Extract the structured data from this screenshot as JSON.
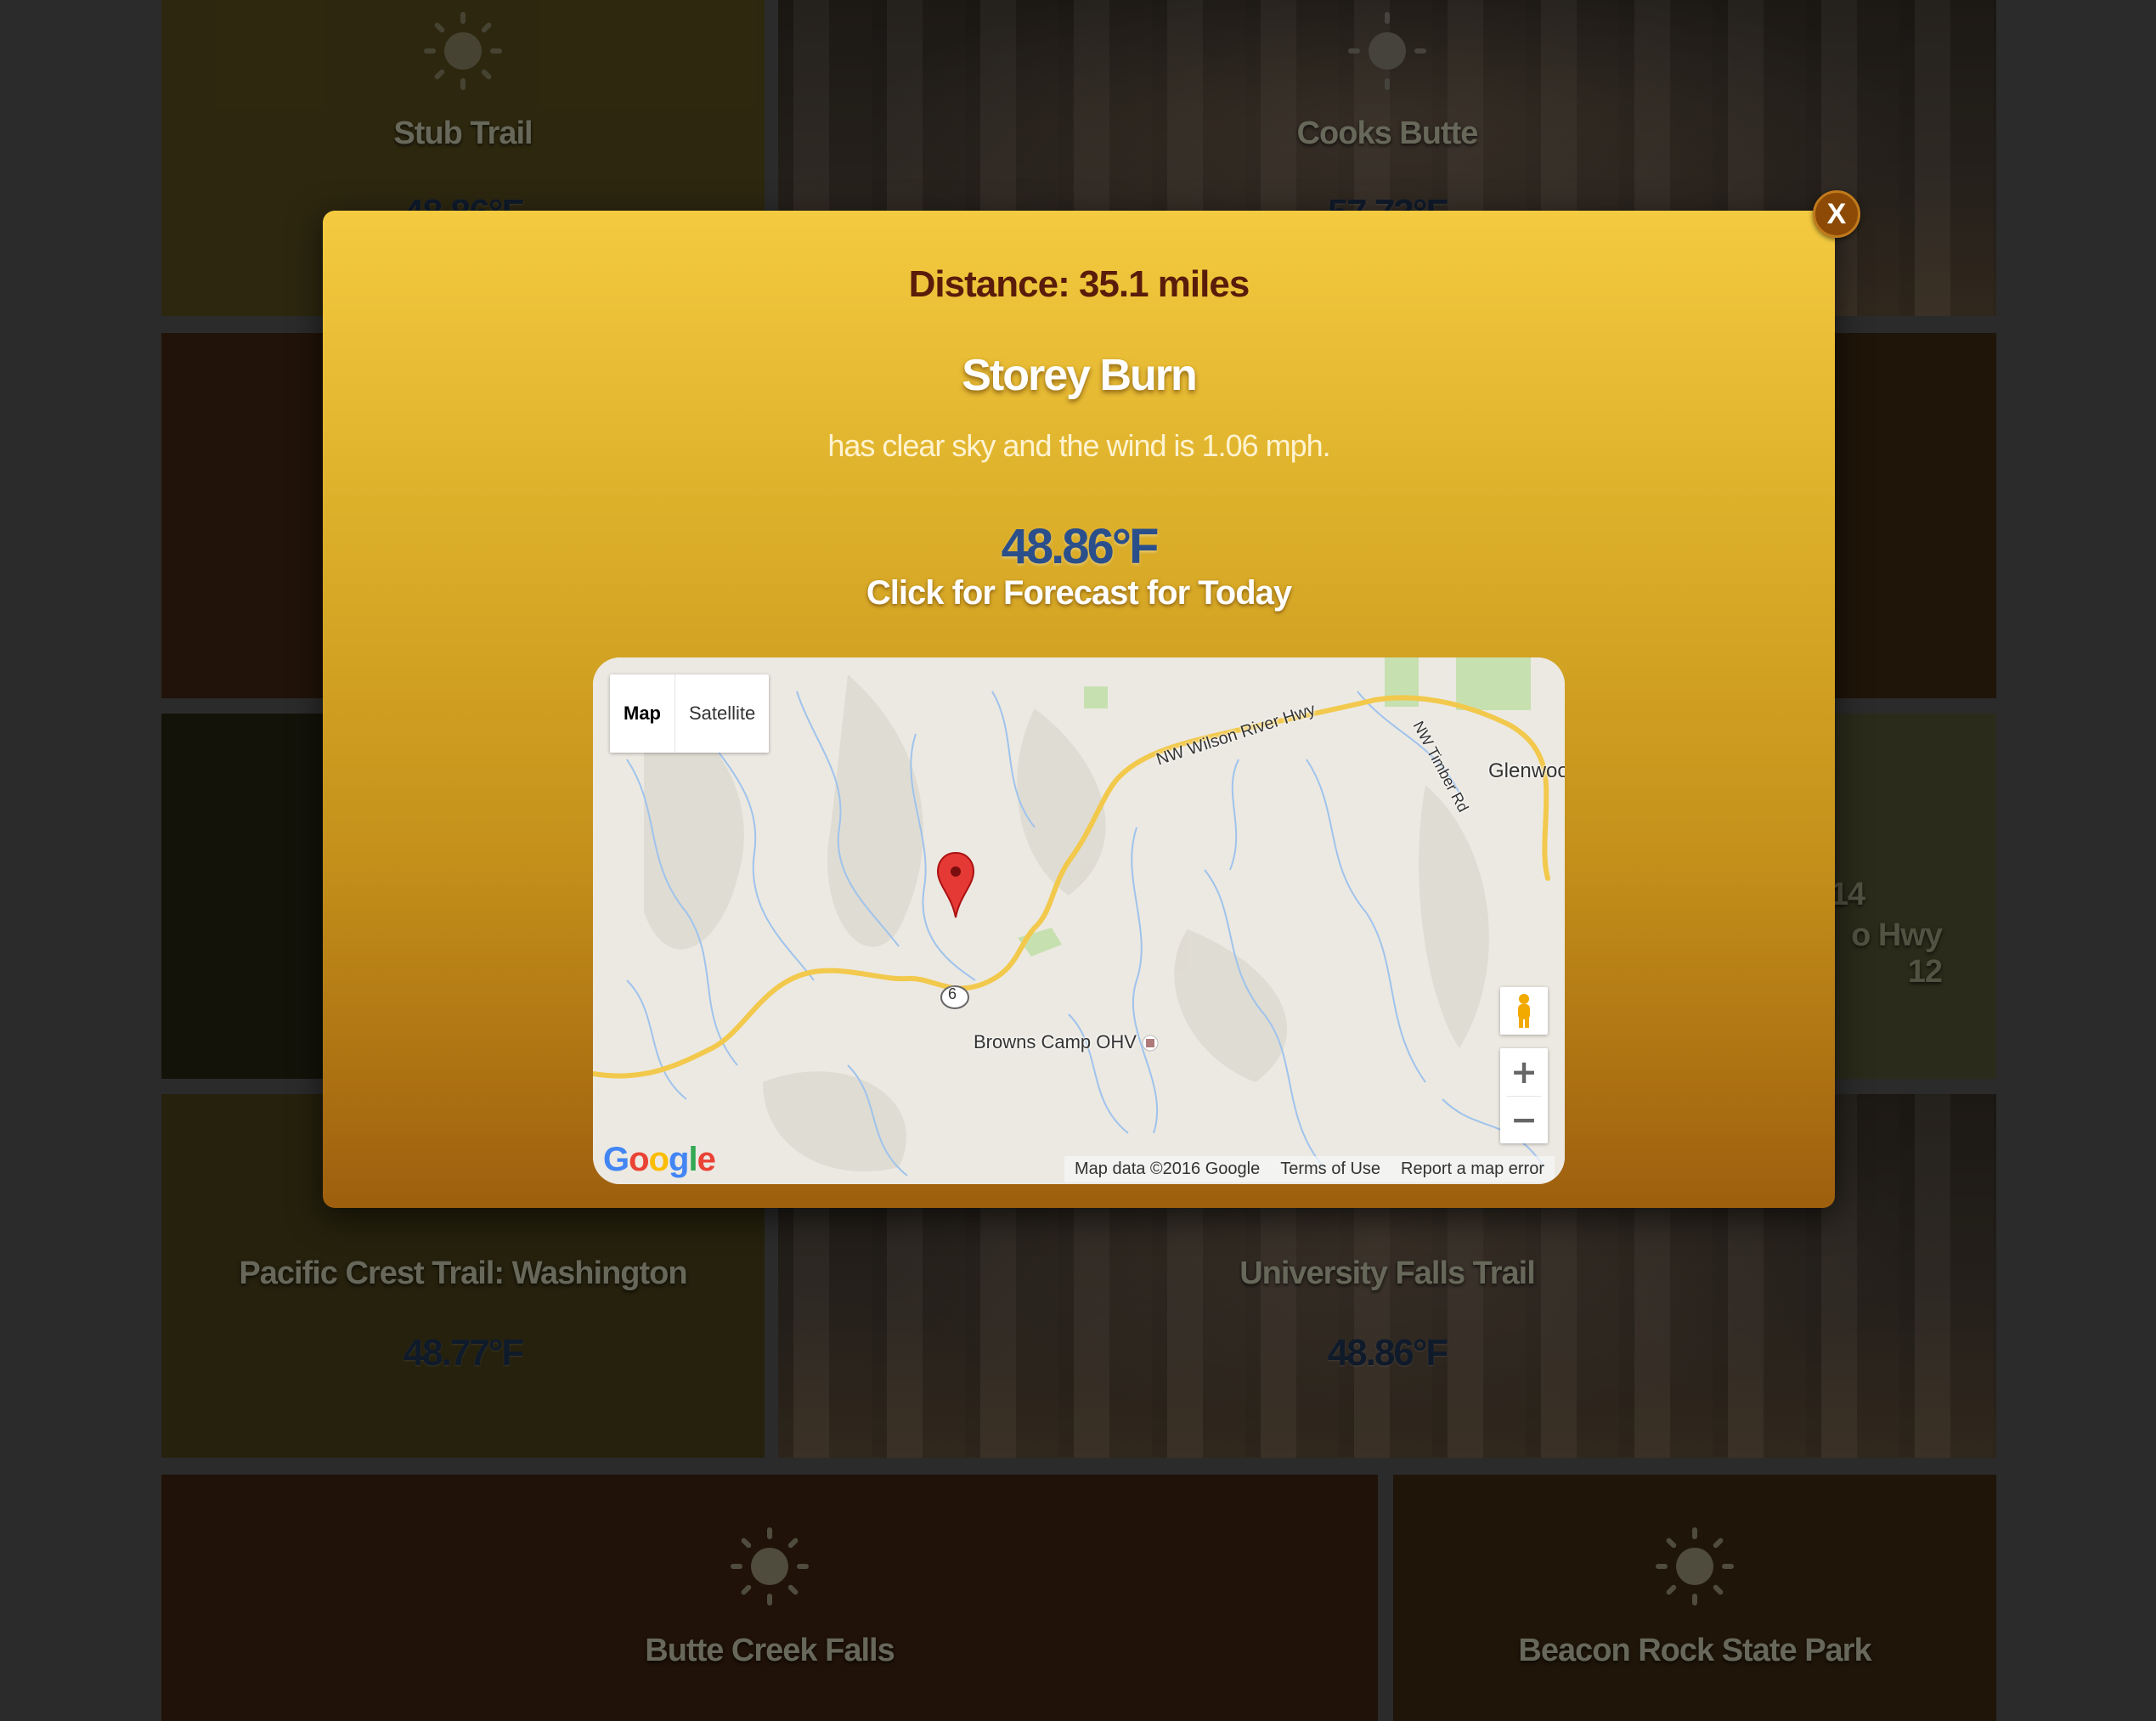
{
  "tiles": {
    "stub_trail": {
      "name": "Stub Trail",
      "temp": "48.86°F"
    },
    "cooks_butte": {
      "name": "Cooks Butte",
      "temp": "57.73°F"
    },
    "right_mid": {
      "line1": "14",
      "line2": "o Hwy 12"
    },
    "pacific_crest": {
      "name": "Pacific Crest Trail: Washington",
      "temp": "48.77°F"
    },
    "university_falls": {
      "name": "University Falls Trail",
      "temp": "48.86°F"
    },
    "butte_creek": {
      "name": "Butte Creek Falls"
    },
    "beacon_rock": {
      "name": "Beacon Rock State Park"
    }
  },
  "modal": {
    "close_label": "X",
    "distance": "Distance: 35.1 miles",
    "place": "Storey Burn",
    "description": "has clear sky and the wind is 1.06 mph.",
    "temp": "48.86°F",
    "forecast_link": "Click for Forecast for Today"
  },
  "map": {
    "type_buttons": {
      "map": "Map",
      "satellite": "Satellite"
    },
    "zoom_in": "+",
    "zoom_out": "−",
    "labels": {
      "highway": "NW Wilson River Hwy",
      "timber_rd": "NW Timber Rd",
      "glenwood": "Glenwoo",
      "browns_camp": "Browns Camp OHV",
      "route": "6"
    },
    "attribution": {
      "data": "Map data ©2016 Google",
      "terms": "Terms of Use",
      "report": "Report a map error"
    },
    "logo": "Google"
  },
  "icons": [
    "sun-icon",
    "map-marker-icon",
    "pegman-icon"
  ],
  "colors": {
    "modal_top": "#f4ca40",
    "modal_bottom": "#9e5f0e",
    "temp_blue": "#2b4f8a"
  }
}
